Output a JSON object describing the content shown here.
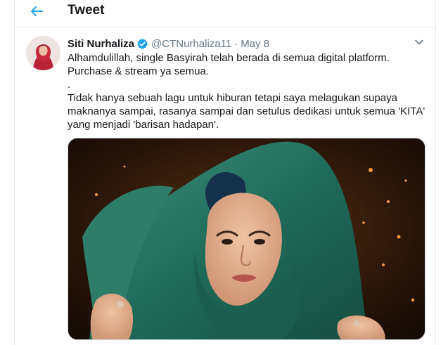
{
  "header": {
    "title": "Tweet",
    "back_icon": "arrow-left-icon"
  },
  "tweet": {
    "author_name": "Siti Nurhaliza",
    "verified_icon": "verified-badge-icon",
    "handle": "@CTNurhaliza11",
    "separator": "·",
    "date": "May 8",
    "caret_icon": "chevron-down-icon",
    "text_lines": [
      "Alhamdulillah, single Basyirah telah berada di semua digital platform.",
      "Purchase & stream ya semua.",
      ".",
      "Tidak hanya sebuah lagu untuk hiburan tetapi saya melagukan supaya maknanya sampai, rasanya sampai dan setulus dedikasi untuk semua 'KITA' yang menjadi 'barisan hadapan'."
    ]
  },
  "colors": {
    "accent": "#1da1f2",
    "text": "#14171a",
    "secondary_text": "#657786",
    "border": "#e6ecf0"
  }
}
